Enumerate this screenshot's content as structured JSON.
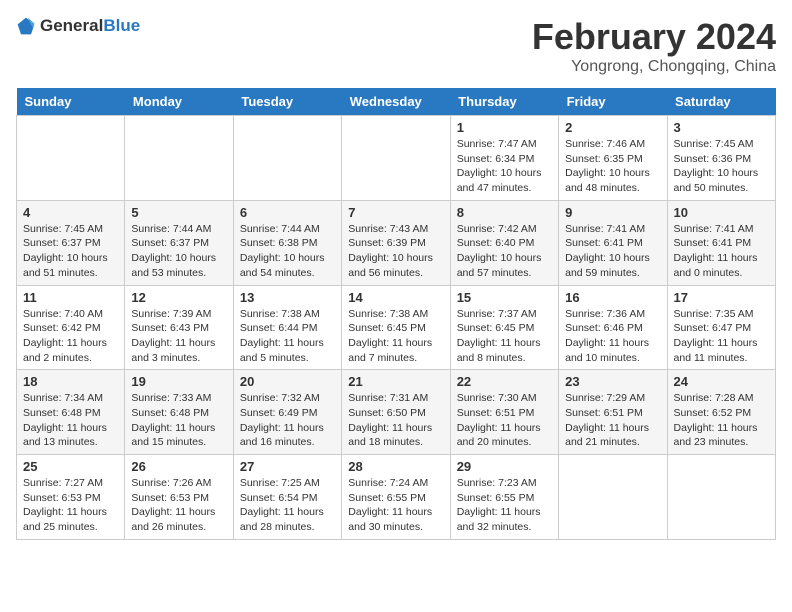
{
  "logo": {
    "general": "General",
    "blue": "Blue"
  },
  "title": "February 2024",
  "subtitle": "Yongrong, Chongqing, China",
  "days_of_week": [
    "Sunday",
    "Monday",
    "Tuesday",
    "Wednesday",
    "Thursday",
    "Friday",
    "Saturday"
  ],
  "weeks": [
    [
      {
        "day": "",
        "detail": ""
      },
      {
        "day": "",
        "detail": ""
      },
      {
        "day": "",
        "detail": ""
      },
      {
        "day": "",
        "detail": ""
      },
      {
        "day": "1",
        "detail": "Sunrise: 7:47 AM\nSunset: 6:34 PM\nDaylight: 10 hours and 47 minutes."
      },
      {
        "day": "2",
        "detail": "Sunrise: 7:46 AM\nSunset: 6:35 PM\nDaylight: 10 hours and 48 minutes."
      },
      {
        "day": "3",
        "detail": "Sunrise: 7:45 AM\nSunset: 6:36 PM\nDaylight: 10 hours and 50 minutes."
      }
    ],
    [
      {
        "day": "4",
        "detail": "Sunrise: 7:45 AM\nSunset: 6:37 PM\nDaylight: 10 hours and 51 minutes."
      },
      {
        "day": "5",
        "detail": "Sunrise: 7:44 AM\nSunset: 6:37 PM\nDaylight: 10 hours and 53 minutes."
      },
      {
        "day": "6",
        "detail": "Sunrise: 7:44 AM\nSunset: 6:38 PM\nDaylight: 10 hours and 54 minutes."
      },
      {
        "day": "7",
        "detail": "Sunrise: 7:43 AM\nSunset: 6:39 PM\nDaylight: 10 hours and 56 minutes."
      },
      {
        "day": "8",
        "detail": "Sunrise: 7:42 AM\nSunset: 6:40 PM\nDaylight: 10 hours and 57 minutes."
      },
      {
        "day": "9",
        "detail": "Sunrise: 7:41 AM\nSunset: 6:41 PM\nDaylight: 10 hours and 59 minutes."
      },
      {
        "day": "10",
        "detail": "Sunrise: 7:41 AM\nSunset: 6:41 PM\nDaylight: 11 hours and 0 minutes."
      }
    ],
    [
      {
        "day": "11",
        "detail": "Sunrise: 7:40 AM\nSunset: 6:42 PM\nDaylight: 11 hours and 2 minutes."
      },
      {
        "day": "12",
        "detail": "Sunrise: 7:39 AM\nSunset: 6:43 PM\nDaylight: 11 hours and 3 minutes."
      },
      {
        "day": "13",
        "detail": "Sunrise: 7:38 AM\nSunset: 6:44 PM\nDaylight: 11 hours and 5 minutes."
      },
      {
        "day": "14",
        "detail": "Sunrise: 7:38 AM\nSunset: 6:45 PM\nDaylight: 11 hours and 7 minutes."
      },
      {
        "day": "15",
        "detail": "Sunrise: 7:37 AM\nSunset: 6:45 PM\nDaylight: 11 hours and 8 minutes."
      },
      {
        "day": "16",
        "detail": "Sunrise: 7:36 AM\nSunset: 6:46 PM\nDaylight: 11 hours and 10 minutes."
      },
      {
        "day": "17",
        "detail": "Sunrise: 7:35 AM\nSunset: 6:47 PM\nDaylight: 11 hours and 11 minutes."
      }
    ],
    [
      {
        "day": "18",
        "detail": "Sunrise: 7:34 AM\nSunset: 6:48 PM\nDaylight: 11 hours and 13 minutes."
      },
      {
        "day": "19",
        "detail": "Sunrise: 7:33 AM\nSunset: 6:48 PM\nDaylight: 11 hours and 15 minutes."
      },
      {
        "day": "20",
        "detail": "Sunrise: 7:32 AM\nSunset: 6:49 PM\nDaylight: 11 hours and 16 minutes."
      },
      {
        "day": "21",
        "detail": "Sunrise: 7:31 AM\nSunset: 6:50 PM\nDaylight: 11 hours and 18 minutes."
      },
      {
        "day": "22",
        "detail": "Sunrise: 7:30 AM\nSunset: 6:51 PM\nDaylight: 11 hours and 20 minutes."
      },
      {
        "day": "23",
        "detail": "Sunrise: 7:29 AM\nSunset: 6:51 PM\nDaylight: 11 hours and 21 minutes."
      },
      {
        "day": "24",
        "detail": "Sunrise: 7:28 AM\nSunset: 6:52 PM\nDaylight: 11 hours and 23 minutes."
      }
    ],
    [
      {
        "day": "25",
        "detail": "Sunrise: 7:27 AM\nSunset: 6:53 PM\nDaylight: 11 hours and 25 minutes."
      },
      {
        "day": "26",
        "detail": "Sunrise: 7:26 AM\nSunset: 6:53 PM\nDaylight: 11 hours and 26 minutes."
      },
      {
        "day": "27",
        "detail": "Sunrise: 7:25 AM\nSunset: 6:54 PM\nDaylight: 11 hours and 28 minutes."
      },
      {
        "day": "28",
        "detail": "Sunrise: 7:24 AM\nSunset: 6:55 PM\nDaylight: 11 hours and 30 minutes."
      },
      {
        "day": "29",
        "detail": "Sunrise: 7:23 AM\nSunset: 6:55 PM\nDaylight: 11 hours and 32 minutes."
      },
      {
        "day": "",
        "detail": ""
      },
      {
        "day": "",
        "detail": ""
      }
    ]
  ]
}
